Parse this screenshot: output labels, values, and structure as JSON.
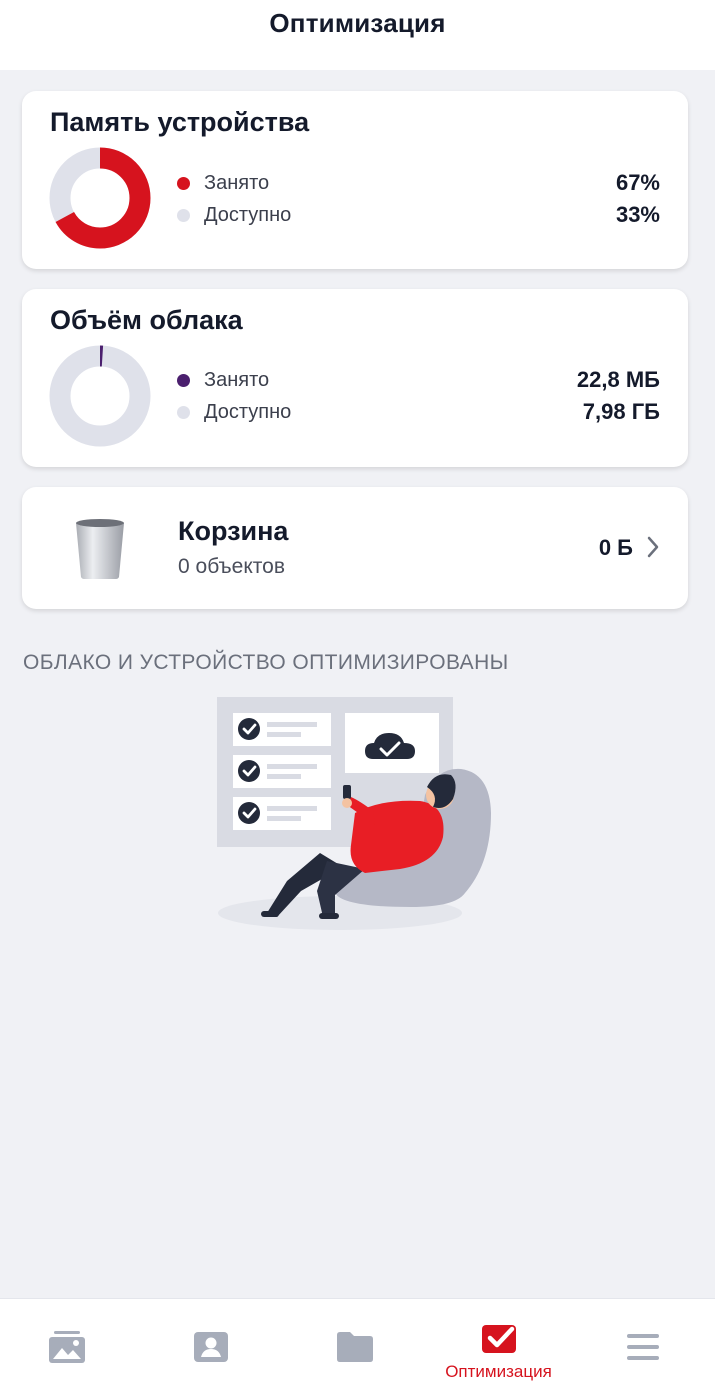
{
  "header": {
    "title": "Оптимизация"
  },
  "device_storage": {
    "title": "Память устройства",
    "used_fraction": 0.67,
    "items": [
      {
        "label": "Занято",
        "value": "67%",
        "color": "#d6131e"
      },
      {
        "label": "Доступно",
        "value": "33%",
        "color": "#dfe1ea"
      }
    ]
  },
  "cloud_storage": {
    "title": "Объём облака",
    "used_fraction": 0.0028,
    "items": [
      {
        "label": "Занято",
        "value": "22,8 МБ",
        "color": "#4b1f6e"
      },
      {
        "label": "Доступно",
        "value": "7,98 ГБ",
        "color": "#dfe1ea"
      }
    ]
  },
  "trash": {
    "title": "Корзина",
    "subtitle": "0 объектов",
    "size": "0 Б",
    "icon": "trash-can-icon"
  },
  "status_heading": "ОБЛАКО И УСТРОЙСТВО ОПТИМИЗИРОВАНЫ",
  "bottom_nav": {
    "active_color": "#d6131e",
    "inactive_color": "#a7adba",
    "items": [
      {
        "icon": "gallery-icon",
        "label": ""
      },
      {
        "icon": "contacts-icon",
        "label": ""
      },
      {
        "icon": "folder-icon",
        "label": ""
      },
      {
        "icon": "optimization-check-icon",
        "label": "Оптимизация"
      },
      {
        "icon": "menu-icon",
        "label": ""
      }
    ]
  }
}
